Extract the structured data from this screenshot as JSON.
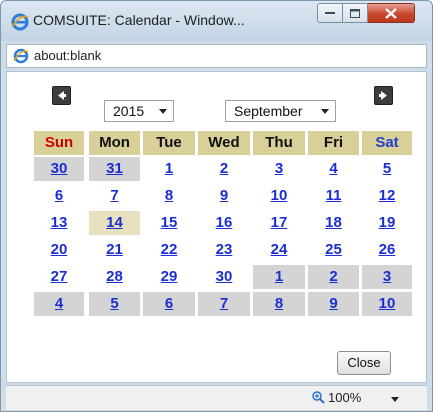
{
  "window": {
    "title": "COMSUITE: Calendar - Window..."
  },
  "address": {
    "url": "about:blank"
  },
  "calendar": {
    "year": "2015",
    "month": "September",
    "weekdays": [
      "Sun",
      "Mon",
      "Tue",
      "Wed",
      "Thu",
      "Fri",
      "Sat"
    ],
    "weeks": [
      [
        {
          "d": "30",
          "other": true
        },
        {
          "d": "31",
          "other": true
        },
        {
          "d": "1"
        },
        {
          "d": "2"
        },
        {
          "d": "3"
        },
        {
          "d": "4"
        },
        {
          "d": "5"
        }
      ],
      [
        {
          "d": "6"
        },
        {
          "d": "7"
        },
        {
          "d": "8"
        },
        {
          "d": "9"
        },
        {
          "d": "10"
        },
        {
          "d": "11"
        },
        {
          "d": "12"
        }
      ],
      [
        {
          "d": "13"
        },
        {
          "d": "14",
          "today": true
        },
        {
          "d": "15"
        },
        {
          "d": "16"
        },
        {
          "d": "17"
        },
        {
          "d": "18"
        },
        {
          "d": "19"
        }
      ],
      [
        {
          "d": "20"
        },
        {
          "d": "21"
        },
        {
          "d": "22"
        },
        {
          "d": "23"
        },
        {
          "d": "24"
        },
        {
          "d": "25"
        },
        {
          "d": "26"
        }
      ],
      [
        {
          "d": "27"
        },
        {
          "d": "28"
        },
        {
          "d": "29"
        },
        {
          "d": "30"
        },
        {
          "d": "1",
          "other": true
        },
        {
          "d": "2",
          "other": true
        },
        {
          "d": "3",
          "other": true
        }
      ],
      [
        {
          "d": "4",
          "other": true
        },
        {
          "d": "5",
          "other": true
        },
        {
          "d": "6",
          "other": true
        },
        {
          "d": "7",
          "other": true
        },
        {
          "d": "8",
          "other": true
        },
        {
          "d": "9",
          "other": true
        },
        {
          "d": "10",
          "other": true
        }
      ]
    ],
    "close_label": "Close"
  },
  "status": {
    "zoom": "100%"
  },
  "colors": {
    "header_bg": "#d9cf98",
    "sunday": "#cc0000",
    "saturday": "#1f3fcc",
    "link": "#1b2ed3",
    "other_month_bg": "#d4d4d4",
    "today_bg": "#e8e1bf"
  },
  "icons": {
    "browser": "ie-logo-icon",
    "prev": "arrow-left-icon",
    "next": "arrow-right-icon",
    "zoom": "zoom-icon"
  }
}
